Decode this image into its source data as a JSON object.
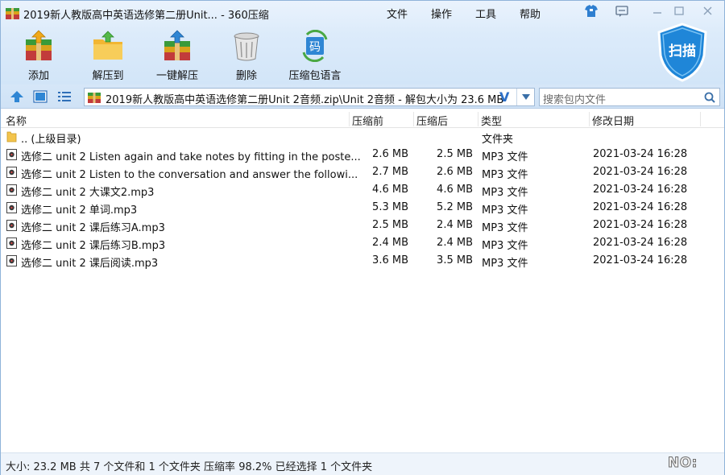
{
  "window": {
    "title": "2019新人教版高中英语选修第二册Unit... - 360压缩",
    "menus": [
      "文件",
      "操作",
      "工具",
      "帮助"
    ]
  },
  "toolbar": {
    "add_label": "添加",
    "extract_to_label": "解压到",
    "one_click_label": "一键解压",
    "delete_label": "删除",
    "language_label": "压缩包语言",
    "scan_label": "扫描",
    "language_icon_text": "码"
  },
  "address": {
    "path": "2019新人教版高中英语选修第二册Unit 2音频.zip\\Unit 2音频 - 解包大小为 23.6 MB",
    "verified_mark": "V",
    "search_placeholder": "搜索包内文件"
  },
  "list": {
    "headers": {
      "name": "名称",
      "packed": "压缩前",
      "compressed": "压缩后",
      "type": "类型",
      "modified": "修改日期"
    },
    "parent": {
      "name": ".. (上级目录)",
      "type": "文件夹"
    },
    "files": [
      {
        "name": "选修二 unit 2  Listen again and take notes by fitting in the poste...",
        "packed": "2.6 MB",
        "compressed": "2.5 MB",
        "type": "MP3 文件",
        "modified": "2021-03-24 16:28"
      },
      {
        "name": "选修二 unit 2  Listen to the conversation and answer the followi...",
        "packed": "2.7 MB",
        "compressed": "2.6 MB",
        "type": "MP3 文件",
        "modified": "2021-03-24 16:28"
      },
      {
        "name": "选修二 unit 2  大课文2.mp3",
        "packed": "4.6 MB",
        "compressed": "4.6 MB",
        "type": "MP3 文件",
        "modified": "2021-03-24 16:28"
      },
      {
        "name": "选修二 unit 2  单词.mp3",
        "packed": "5.3 MB",
        "compressed": "5.2 MB",
        "type": "MP3 文件",
        "modified": "2021-03-24 16:28"
      },
      {
        "name": "选修二 unit 2  课后练习A.mp3",
        "packed": "2.5 MB",
        "compressed": "2.4 MB",
        "type": "MP3 文件",
        "modified": "2021-03-24 16:28"
      },
      {
        "name": "选修二 unit 2  课后练习B.mp3",
        "packed": "2.4 MB",
        "compressed": "2.4 MB",
        "type": "MP3 文件",
        "modified": "2021-03-24 16:28"
      },
      {
        "name": "选修二 unit 2  课后阅读.mp3",
        "packed": "3.6 MB",
        "compressed": "3.5 MB",
        "type": "MP3 文件",
        "modified": "2021-03-24 16:28"
      }
    ]
  },
  "status": {
    "text": "大小: 23.2 MB 共 7 个文件和 1 个文件夹 压缩率 98.2% 已经选择 1 个文件夹",
    "badge": "NO:"
  },
  "icons": {
    "app": "archive-icon",
    "file": "audio-file-icon",
    "folder": "folder-icon"
  },
  "colors": {
    "header_top": "#eaf3fd",
    "header_bottom": "#d2e5f8",
    "accent_blue": "#2c6fc7",
    "scan_shield": "#1f86d8"
  }
}
